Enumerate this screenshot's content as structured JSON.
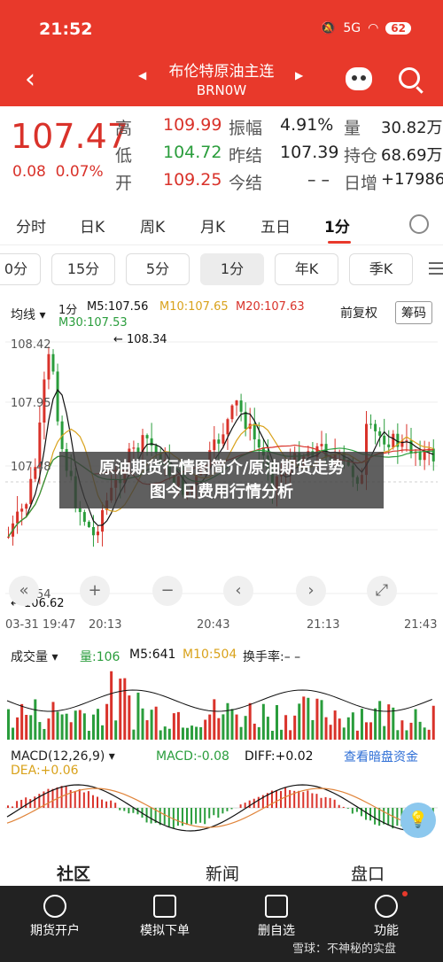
{
  "status": {
    "time": "21:52",
    "battery": "62",
    "signal": "5G"
  },
  "header": {
    "title": "布伦特原油主连",
    "subtitle": "BRN0W"
  },
  "quote": {
    "price": "107.47",
    "change": "0.08",
    "change_pct": "0.07%",
    "high_label": "高",
    "high": "109.99",
    "low_label": "低",
    "low": "104.72",
    "open_label": "开",
    "open": "109.25",
    "amp_label": "振幅",
    "amp": "4.91%",
    "prev_label": "昨结",
    "prev": "107.39",
    "today_label": "今结",
    "today": "– –",
    "vol_label": "量",
    "vol": "30.82万",
    "oi_label": "持仓",
    "oi": "68.69万",
    "inc_label": "日增",
    "inc": "+17986"
  },
  "tabs": [
    "分时",
    "日K",
    "周K",
    "月K",
    "五日",
    "1分"
  ],
  "tabs_active": "1分",
  "pills": [
    "0分",
    "15分",
    "5分",
    "1分",
    "年K",
    "季K"
  ],
  "indicator": {
    "mode": "均线",
    "period": "1分",
    "m5": "M5:107.56",
    "m10": "M10:107.65",
    "m20": "M20:107.63",
    "m30": "M30:107.53",
    "adjust": "前复权",
    "chip": "筹码"
  },
  "chart": {
    "y_ticks": [
      "108.42",
      "107.95",
      "107.48",
      "106.54"
    ],
    "hi_marker": "108.34",
    "lo_marker": "106.62",
    "x_ticks": [
      "03-31 19:47",
      "20:13",
      "20:43",
      "21:13",
      "21:43"
    ]
  },
  "banner": {
    "line1": "原油期货行情图简介/原油期货走势",
    "line2": "图今日费用行情分析"
  },
  "volume": {
    "label": "成交量",
    "vol": "量:106",
    "m5": "M5:641",
    "m10": "M10:504",
    "turnover": "换手率:– –"
  },
  "macd": {
    "label": "MACD(12,26,9)",
    "macd": "MACD:-0.08",
    "diff": "DIFF:+0.02",
    "dea": "DEA:+0.06",
    "link": "查看暗盘资金"
  },
  "segtabs": [
    "社区",
    "新闻",
    "盘口"
  ],
  "bottom_nav": [
    "期货开户",
    "模拟下单",
    "删自选",
    "功能"
  ],
  "watermark": "雪球：不神秘的实盘",
  "colors": {
    "brand": "#e8392b",
    "up": "#d9322a",
    "down": "#2a9d3c"
  }
}
